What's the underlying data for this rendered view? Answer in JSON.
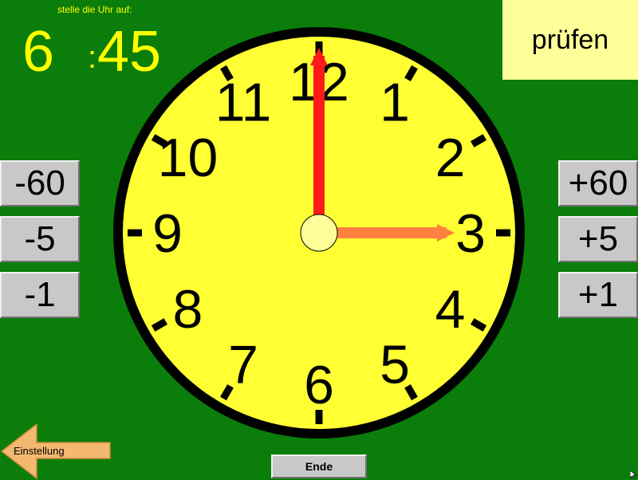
{
  "instruction": "stelle die Uhr auf:",
  "target": {
    "hour": "6",
    "separator": ":",
    "minute": "45"
  },
  "check_label": "prüfen",
  "left_buttons": [
    "-60",
    "-5",
    "-1"
  ],
  "right_buttons": [
    "+60",
    "+5",
    "+1"
  ],
  "clock": {
    "numerals": [
      "12",
      "1",
      "2",
      "3",
      "4",
      "5",
      "6",
      "7",
      "8",
      "9",
      "10",
      "11"
    ],
    "hour_hand_value": 3,
    "minute_hand_value": 0,
    "face_color": "#ffff33",
    "rim_color": "#000000",
    "minute_hand_color": "#ff1a1a",
    "hour_hand_color": "#ff8040",
    "hub_color": "#ffff99"
  },
  "back_label": "Einstellung",
  "end_label": "Ende",
  "colors": {
    "background": "#0a7d0a",
    "accent_text": "#ffff00",
    "check_button": "#ffff99",
    "back_arrow": "#f5b870"
  }
}
